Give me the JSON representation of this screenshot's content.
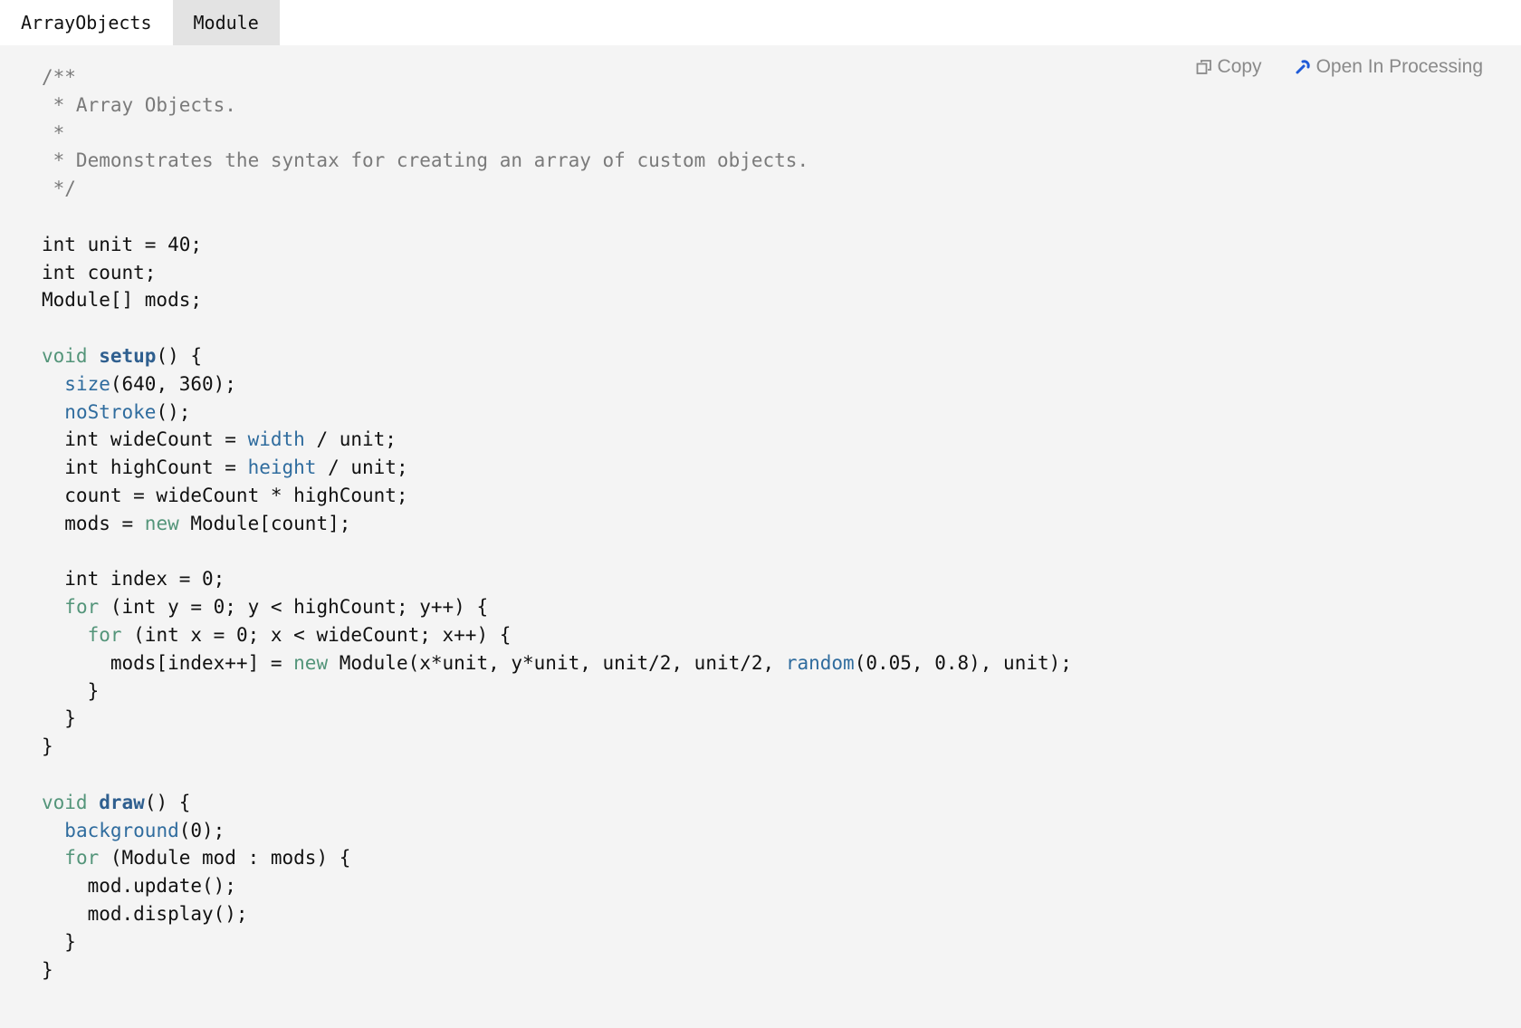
{
  "tabs": [
    {
      "label": "ArrayObjects",
      "active": true
    },
    {
      "label": "Module",
      "active": false
    }
  ],
  "toolbar": {
    "copy_label": "Copy",
    "open_label": "Open In Processing",
    "copy_icon": "copy-icon",
    "open_icon": "processing-icon",
    "open_icon_color": "#1f5bd8"
  },
  "colors": {
    "comment": "#7a7a7a",
    "keyword": "#54957a",
    "function": "#2f6c9e",
    "function_def": "#2f5f8f",
    "text": "#111111",
    "panel_bg": "#f4f4f4",
    "inactive_tab_bg": "#e3e3e3"
  },
  "code": {
    "lines": [
      [
        {
          "t": "/**",
          "c": "comment"
        }
      ],
      [
        {
          "t": " * Array Objects.",
          "c": "comment"
        }
      ],
      [
        {
          "t": " *",
          "c": "comment"
        }
      ],
      [
        {
          "t": " * Demonstrates the syntax for creating an array of custom objects.",
          "c": "comment"
        }
      ],
      [
        {
          "t": " */",
          "c": "comment"
        }
      ],
      [],
      [
        {
          "t": "int unit = 40;",
          "c": "plain"
        }
      ],
      [
        {
          "t": "int count;",
          "c": "plain"
        }
      ],
      [
        {
          "t": "Module[] mods;",
          "c": "plain"
        }
      ],
      [],
      [
        {
          "t": "void",
          "c": "keyword"
        },
        {
          "t": " ",
          "c": "plain"
        },
        {
          "t": "setup",
          "c": "funcdef"
        },
        {
          "t": "() {",
          "c": "plain"
        }
      ],
      [
        {
          "t": "  ",
          "c": "plain"
        },
        {
          "t": "size",
          "c": "func"
        },
        {
          "t": "(640, 360);",
          "c": "plain"
        }
      ],
      [
        {
          "t": "  ",
          "c": "plain"
        },
        {
          "t": "noStroke",
          "c": "func"
        },
        {
          "t": "();",
          "c": "plain"
        }
      ],
      [
        {
          "t": "  int wideCount = ",
          "c": "plain"
        },
        {
          "t": "width",
          "c": "func"
        },
        {
          "t": " / unit;",
          "c": "plain"
        }
      ],
      [
        {
          "t": "  int highCount = ",
          "c": "plain"
        },
        {
          "t": "height",
          "c": "func"
        },
        {
          "t": " / unit;",
          "c": "plain"
        }
      ],
      [
        {
          "t": "  count = wideCount * highCount;",
          "c": "plain"
        }
      ],
      [
        {
          "t": "  mods = ",
          "c": "plain"
        },
        {
          "t": "new",
          "c": "keyword"
        },
        {
          "t": " Module[count];",
          "c": "plain"
        }
      ],
      [],
      [
        {
          "t": "  int index = 0;",
          "c": "plain"
        }
      ],
      [
        {
          "t": "  ",
          "c": "plain"
        },
        {
          "t": "for",
          "c": "keyword"
        },
        {
          "t": " (int y = 0; y < highCount; y++) {",
          "c": "plain"
        }
      ],
      [
        {
          "t": "    ",
          "c": "plain"
        },
        {
          "t": "for",
          "c": "keyword"
        },
        {
          "t": " (int x = 0; x < wideCount; x++) {",
          "c": "plain"
        }
      ],
      [
        {
          "t": "      mods[index++] = ",
          "c": "plain"
        },
        {
          "t": "new",
          "c": "keyword"
        },
        {
          "t": " Module(x*unit, y*unit, unit/2, unit/2, ",
          "c": "plain"
        },
        {
          "t": "random",
          "c": "func"
        },
        {
          "t": "(0.05, 0.8), unit);",
          "c": "plain"
        }
      ],
      [
        {
          "t": "    }",
          "c": "plain"
        }
      ],
      [
        {
          "t": "  }",
          "c": "plain"
        }
      ],
      [
        {
          "t": "}",
          "c": "plain"
        }
      ],
      [],
      [
        {
          "t": "void",
          "c": "keyword"
        },
        {
          "t": " ",
          "c": "plain"
        },
        {
          "t": "draw",
          "c": "funcdef"
        },
        {
          "t": "() {",
          "c": "plain"
        }
      ],
      [
        {
          "t": "  ",
          "c": "plain"
        },
        {
          "t": "background",
          "c": "func"
        },
        {
          "t": "(0);",
          "c": "plain"
        }
      ],
      [
        {
          "t": "  ",
          "c": "plain"
        },
        {
          "t": "for",
          "c": "keyword"
        },
        {
          "t": " (Module mod : mods) {",
          "c": "plain"
        }
      ],
      [
        {
          "t": "    mod.update();",
          "c": "plain"
        }
      ],
      [
        {
          "t": "    mod.display();",
          "c": "plain"
        }
      ],
      [
        {
          "t": "  }",
          "c": "plain"
        }
      ],
      [
        {
          "t": "}",
          "c": "plain"
        }
      ]
    ]
  }
}
